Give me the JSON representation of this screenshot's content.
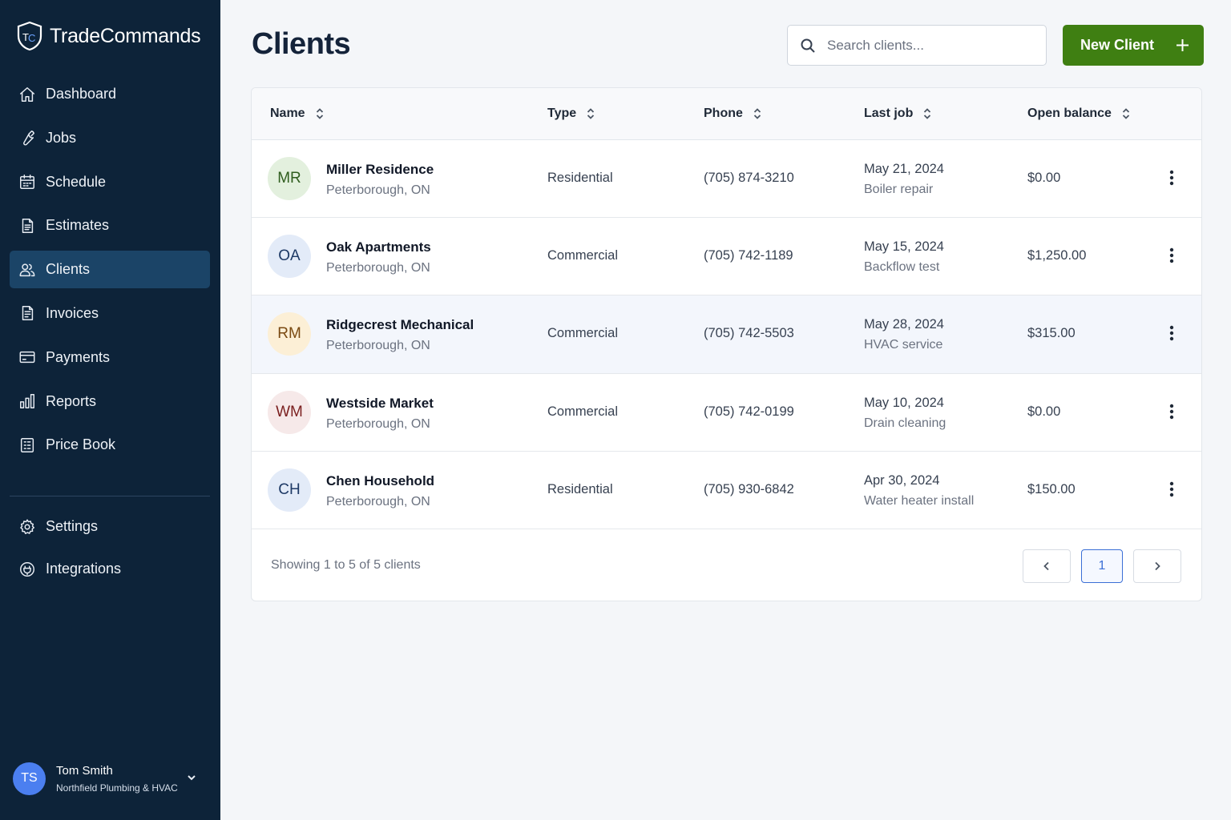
{
  "brand": {
    "name": "TradeCommands",
    "logo_text": "TC"
  },
  "sidebar": {
    "items": [
      {
        "label": "Dashboard",
        "icon": "home-icon"
      },
      {
        "label": "Jobs",
        "icon": "wrench-icon"
      },
      {
        "label": "Schedule",
        "icon": "calendar-icon"
      },
      {
        "label": "Estimates",
        "icon": "document-icon"
      },
      {
        "label": "Clients",
        "icon": "users-icon",
        "active": true
      },
      {
        "label": "Invoices",
        "icon": "invoice-icon"
      },
      {
        "label": "Payments",
        "icon": "credit-card-icon"
      },
      {
        "label": "Reports",
        "icon": "bar-chart-icon"
      },
      {
        "label": "Price Book",
        "icon": "price-book-icon"
      }
    ],
    "secondary": [
      {
        "label": "Settings",
        "icon": "gear-icon"
      },
      {
        "label": "Integrations",
        "icon": "integrations-icon"
      }
    ],
    "user": {
      "initials": "TS",
      "name": "Tom Smith",
      "org": "Northfield Plumbing & HVAC"
    }
  },
  "header": {
    "title": "Clients",
    "search_placeholder": "Search clients...",
    "new_button_label": "New Client"
  },
  "table": {
    "columns": [
      "Name",
      "Type",
      "Phone",
      "Last job",
      "Open balance"
    ],
    "rows": [
      {
        "initials": "MR",
        "name": "Miller Residence",
        "location": "Peterborough, ON",
        "type": "Residential",
        "phone": "(705) 874-3210",
        "last_job_date": "May 21, 2024",
        "last_job_desc": "Boiler repair",
        "balance": "$0.00",
        "avatar_bg": "#e3f0de",
        "avatar_fg": "#2f5d1e"
      },
      {
        "initials": "OA",
        "name": "Oak Apartments",
        "location": "Peterborough, ON",
        "type": "Commercial",
        "phone": "(705) 742-1189",
        "last_job_date": "May 15, 2024",
        "last_job_desc": "Backflow test",
        "balance": "$1,250.00",
        "avatar_bg": "#e3ebf8",
        "avatar_fg": "#1e3a66"
      },
      {
        "initials": "RM",
        "name": "Ridgecrest Mechanical",
        "location": "Peterborough, ON",
        "type": "Commercial",
        "phone": "(705) 742-5503",
        "last_job_date": "May 28, 2024",
        "last_job_desc": "HVAC service",
        "balance": "$315.00",
        "avatar_bg": "#fcefd6",
        "avatar_fg": "#7a4a12",
        "highlight": true
      },
      {
        "initials": "WM",
        "name": "Westside Market",
        "location": "Peterborough, ON",
        "type": "Commercial",
        "phone": "(705) 742-0199",
        "last_job_date": "May 10, 2024",
        "last_job_desc": "Drain cleaning",
        "balance": "$0.00",
        "avatar_bg": "#f6e9e9",
        "avatar_fg": "#7a1f1f"
      },
      {
        "initials": "CH",
        "name": "Chen Household",
        "location": "Peterborough, ON",
        "type": "Residential",
        "phone": "(705) 930-6842",
        "last_job_date": "Apr 30, 2024",
        "last_job_desc": "Water heater install",
        "balance": "$150.00",
        "avatar_bg": "#e3ebf8",
        "avatar_fg": "#1e3a66"
      }
    ]
  },
  "pagination": {
    "summary": "Showing 1 to 5 of 5 clients",
    "current_page": "1"
  },
  "colors": {
    "sidebar_bg": "#0d2339",
    "sidebar_active": "#1b4467",
    "primary_button": "#3f7f12",
    "accent": "#3b6fd6"
  }
}
